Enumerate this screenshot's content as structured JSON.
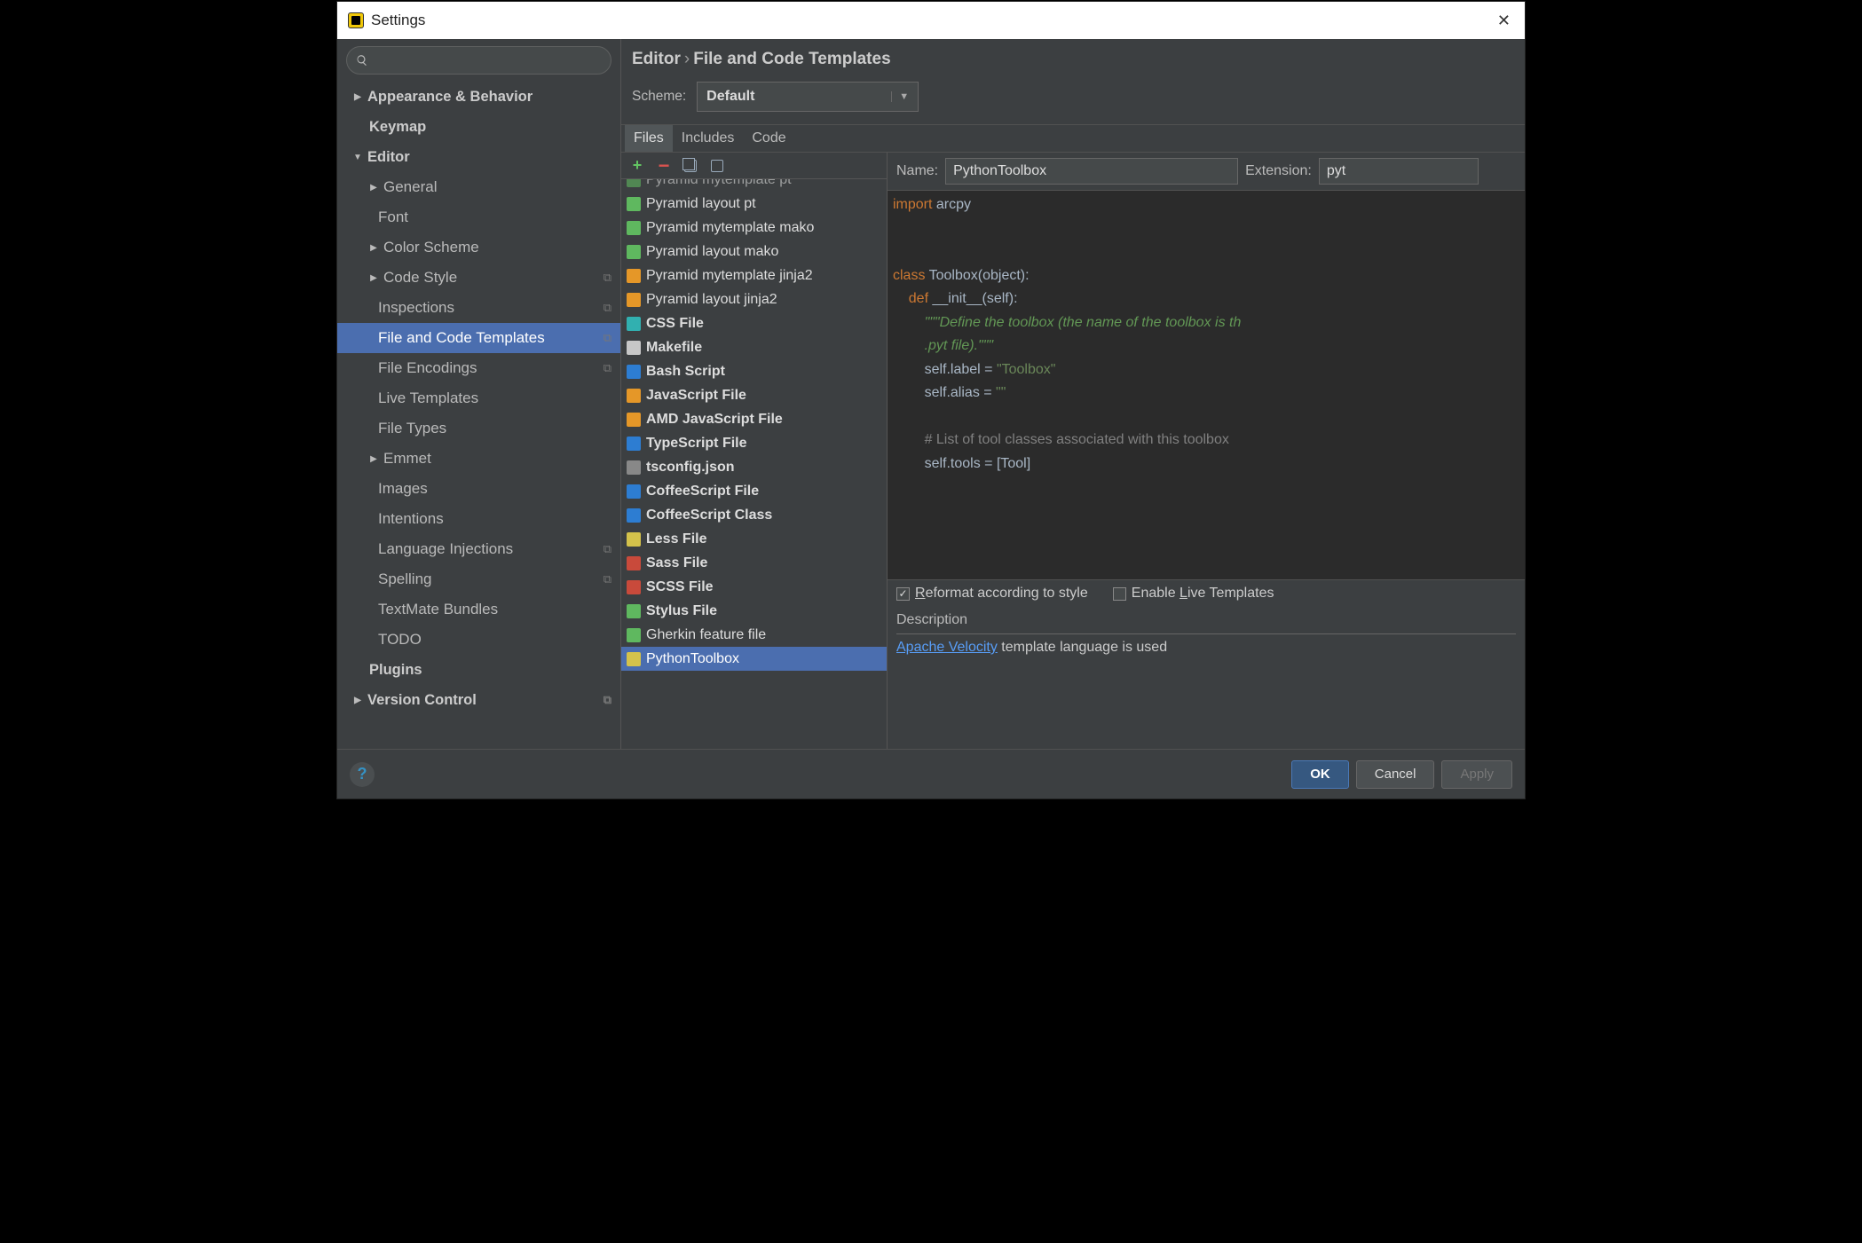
{
  "window": {
    "title": "Settings"
  },
  "breadcrumb": {
    "root": "Editor",
    "leaf": "File and Code Templates"
  },
  "scheme": {
    "label": "Scheme:",
    "value": "Default"
  },
  "nav": [
    {
      "label": "Appearance & Behavior",
      "caret": "▶",
      "bold": true
    },
    {
      "label": "Keymap",
      "bold": true,
      "ind": 1
    },
    {
      "label": "Editor",
      "caret": "▼",
      "bold": true
    },
    {
      "label": "General",
      "caret": "▶",
      "ind": 1
    },
    {
      "label": "Font",
      "ind": 2
    },
    {
      "label": "Color Scheme",
      "caret": "▶",
      "ind": 1
    },
    {
      "label": "Code Style",
      "caret": "▶",
      "ind": 1,
      "dup": true
    },
    {
      "label": "Inspections",
      "ind": 2,
      "dup": true
    },
    {
      "label": "File and Code Templates",
      "ind": 2,
      "dup": true,
      "selected": true
    },
    {
      "label": "File Encodings",
      "ind": 2,
      "dup": true
    },
    {
      "label": "Live Templates",
      "ind": 2
    },
    {
      "label": "File Types",
      "ind": 2
    },
    {
      "label": "Emmet",
      "caret": "▶",
      "ind": 1
    },
    {
      "label": "Images",
      "ind": 2
    },
    {
      "label": "Intentions",
      "ind": 2
    },
    {
      "label": "Language Injections",
      "ind": 2,
      "dup": true
    },
    {
      "label": "Spelling",
      "ind": 2,
      "dup": true
    },
    {
      "label": "TextMate Bundles",
      "ind": 2
    },
    {
      "label": "TODO",
      "ind": 2
    },
    {
      "label": "Plugins",
      "bold": true,
      "ind": 1
    },
    {
      "label": "Version Control",
      "caret": "▶",
      "bold": true,
      "dup": true
    }
  ],
  "tabs": [
    "Files",
    "Includes",
    "Code"
  ],
  "activeTab": 0,
  "templates": [
    {
      "label": "Pyramid mytemplate pt",
      "bold": false,
      "icon": "ic-green",
      "clip": true
    },
    {
      "label": "Pyramid layout pt",
      "icon": "ic-green"
    },
    {
      "label": "Pyramid mytemplate mako",
      "icon": "ic-green"
    },
    {
      "label": "Pyramid layout mako",
      "icon": "ic-green"
    },
    {
      "label": "Pyramid mytemplate jinja2",
      "icon": "ic-orange"
    },
    {
      "label": "Pyramid layout jinja2",
      "icon": "ic-orange"
    },
    {
      "label": "CSS File",
      "bold": true,
      "icon": "ic-teal"
    },
    {
      "label": "Makefile",
      "bold": true,
      "icon": "ic-pale"
    },
    {
      "label": "Bash Script",
      "bold": true,
      "icon": "ic-blue"
    },
    {
      "label": "JavaScript File",
      "bold": true,
      "icon": "ic-orange"
    },
    {
      "label": "AMD JavaScript File",
      "bold": true,
      "icon": "ic-orange"
    },
    {
      "label": "TypeScript File",
      "bold": true,
      "icon": "ic-blue"
    },
    {
      "label": "tsconfig.json",
      "bold": true,
      "icon": "ic-gray"
    },
    {
      "label": "CoffeeScript File",
      "bold": true,
      "icon": "ic-blue"
    },
    {
      "label": "CoffeeScript Class",
      "bold": true,
      "icon": "ic-blue"
    },
    {
      "label": "Less File",
      "bold": true,
      "icon": "ic-yellow"
    },
    {
      "label": "Sass File",
      "bold": true,
      "icon": "ic-red"
    },
    {
      "label": "SCSS File",
      "bold": true,
      "icon": "ic-red"
    },
    {
      "label": "Stylus File",
      "bold": true,
      "icon": "ic-green"
    },
    {
      "label": "Gherkin feature file",
      "icon": "ic-green"
    },
    {
      "label": "PythonToolbox",
      "icon": "ic-yellow",
      "selected": true
    }
  ],
  "nameField": {
    "label": "Name:",
    "value": "PythonToolbox"
  },
  "extField": {
    "label": "Extension:",
    "value": "pyt"
  },
  "code_lines": [
    {
      "t": "kw",
      "s": "import"
    },
    {
      "t": "",
      "s": " arcpy\n\n\n"
    },
    {
      "t": "kw",
      "s": "class"
    },
    {
      "t": "",
      "s": " Toolbox(object):\n    "
    },
    {
      "t": "kw",
      "s": "def"
    },
    {
      "t": "",
      "s": " __init__(self):\n        "
    },
    {
      "t": "doc",
      "s": "\"\"\"Define the toolbox (the name of the toolbox is th\n        .pyt file).\"\"\""
    },
    {
      "t": "",
      "s": "\n        self.label = "
    },
    {
      "t": "str",
      "s": "\"Toolbox\""
    },
    {
      "t": "",
      "s": "\n        self.alias = "
    },
    {
      "t": "str",
      "s": "\"\""
    },
    {
      "t": "",
      "s": "\n\n        "
    },
    {
      "t": "com",
      "s": "# List of tool classes associated with this toolbox"
    },
    {
      "t": "",
      "s": "\n        self.tools = [Tool]"
    }
  ],
  "opts": {
    "reformat_label": "eformat according to style",
    "reformat_accel": "R",
    "reformat_on": true,
    "live_label": "Enable ",
    "live_accel": "L",
    "live_rest": "ive Templates",
    "live_on": false
  },
  "desc": {
    "header": "Description",
    "linkText": "Apache Velocity",
    "rest": " template language is used"
  },
  "buttons": {
    "ok": "OK",
    "cancel": "Cancel",
    "apply": "Apply"
  }
}
